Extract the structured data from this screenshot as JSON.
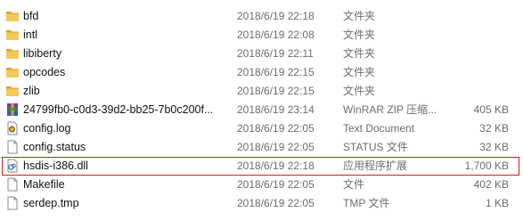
{
  "files": [
    {
      "name": "bfd",
      "date": "2018/6/19 22:18",
      "type": "文件夹",
      "size": "",
      "icon": "folder-icon"
    },
    {
      "name": "intl",
      "date": "2018/6/19 22:08",
      "type": "文件夹",
      "size": "",
      "icon": "folder-icon"
    },
    {
      "name": "libiberty",
      "date": "2018/6/19 22:11",
      "type": "文件夹",
      "size": "",
      "icon": "folder-icon"
    },
    {
      "name": "opcodes",
      "date": "2018/6/19 22:15",
      "type": "文件夹",
      "size": "",
      "icon": "folder-icon"
    },
    {
      "name": "zlib",
      "date": "2018/6/19 22:15",
      "type": "文件夹",
      "size": "",
      "icon": "folder-icon"
    },
    {
      "name": "24799fb0-c0d3-39d2-bb25-7b0c200f...",
      "date": "2018/6/19 23:14",
      "type": "WinRAR ZIP 压缩...",
      "size": "405 KB",
      "icon": "winrar-archive-icon"
    },
    {
      "name": "config.log",
      "date": "2018/6/19 22:05",
      "type": "Text Document",
      "size": "32 KB",
      "icon": "log-file-icon"
    },
    {
      "name": "config.status",
      "date": "2018/6/19 22:05",
      "type": "STATUS 文件",
      "size": "32 KB",
      "icon": "file-icon"
    },
    {
      "name": "hsdis-i386.dll",
      "date": "2018/6/19 22:18",
      "type": "应用程序扩展",
      "size": "1,700 KB",
      "icon": "dll-file-icon"
    },
    {
      "name": "Makefile",
      "date": "2018/6/19 22:05",
      "type": "文件",
      "size": "402 KB",
      "icon": "file-icon"
    },
    {
      "name": "serdep.tmp",
      "date": "2018/6/19 22:05",
      "type": "TMP 文件",
      "size": "1 KB",
      "icon": "file-icon"
    }
  ],
  "highlight_color": "#d11e1e",
  "folder_color": "#e8b93c"
}
